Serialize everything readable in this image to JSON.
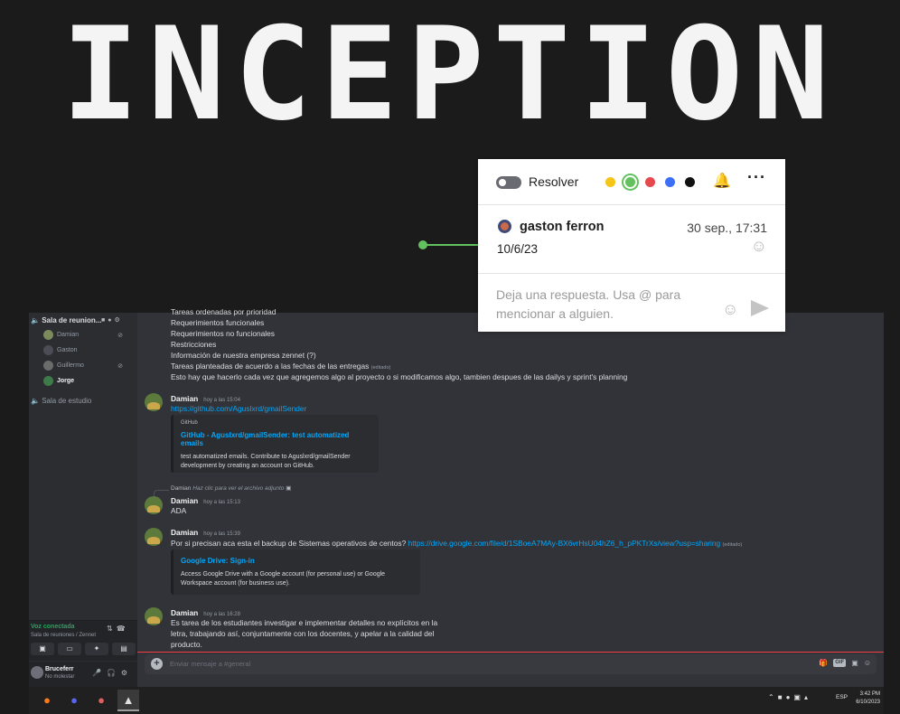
{
  "slide": {
    "title": "INCEPTION"
  },
  "comment_popup": {
    "resolve_label": "Resolver",
    "colors": [
      "#f5c518",
      "#63c25f",
      "#e5484d",
      "#3b6ff5",
      "#111111"
    ],
    "selected_color": "#63c25f",
    "author": "gaston ferron",
    "time": "30 sep., 17:31",
    "text": "10/6/23",
    "reply_placeholder": "Deja una respuesta. Usa @ para mencionar a alguien."
  },
  "discord": {
    "sidebar": {
      "voice_channel": "Sala de reunion...",
      "users": [
        "Damian",
        "Gaston",
        "Guillermo",
        "Jorge"
      ],
      "second_channel": "Sala de estudio",
      "voice_status": "Voz conectada",
      "voice_sub": "Sala de reuniones / Zennet",
      "username": "Bruceferr",
      "user_status": "No molestar"
    },
    "prev_lines": [
      "Tareas ordenadas por prioridad",
      "Requerimientos funcionales",
      "Requerimientos no funcionales",
      "Restricciones",
      "Información de nuestra empresa zennet (?)",
      "Tareas planteadas de acuerdo a las fechas de las entregas",
      "Esto hay que hacerlo cada vez que agregemos algo al proyecto o si modificamos algo, tambien despues de las dailys y sprint's planning"
    ],
    "edited_tag": "(editado)",
    "messages": [
      {
        "author": "Damian",
        "time": "hoy a las 15:04",
        "link": "https://github.com/Aguslxrd/gmailSender",
        "embed_provider": "GitHub",
        "embed_title": "GitHub - Aguslxrd/gmailSender: test automatized emails",
        "embed_desc": "test automatized emails. Contribute to Aguslxrd/gmailSender development by creating an account on GitHub."
      },
      {
        "reply_author": "Damian",
        "reply_text": "Haz clic para ver el archivo adjunto",
        "author": "Damian",
        "time": "hoy a las 15:13",
        "text": "ADA"
      },
      {
        "author": "Damian",
        "time": "hoy a las 15:39",
        "text": "Por si precisan aca esta el backup de Sistemas operativos de centos?",
        "link": "https://drive.google.com/file/d/1SBoeA7MAy-BX6vrHsU04hZ6_h_pPKTrXs/view?usp=sharing",
        "embed_title": "Google Drive: Sign-in",
        "embed_desc": "Access Google Drive with a Google account (for personal use) or Google Workspace account (for business use)."
      },
      {
        "author": "Damian",
        "time": "hoy a las 16:28",
        "lines": [
          "Es tarea de los estudiantes investigar e implementar detalles no explícitos en la",
          "letra, trabajando así, conjuntamente con los docentes, y apelar a la calidad del",
          "producto."
        ]
      }
    ],
    "input_placeholder": "Enviar mensaje a #general"
  },
  "taskbar": {
    "lang": "ESP",
    "time": "3:42 PM",
    "date": "6/10/2023"
  }
}
